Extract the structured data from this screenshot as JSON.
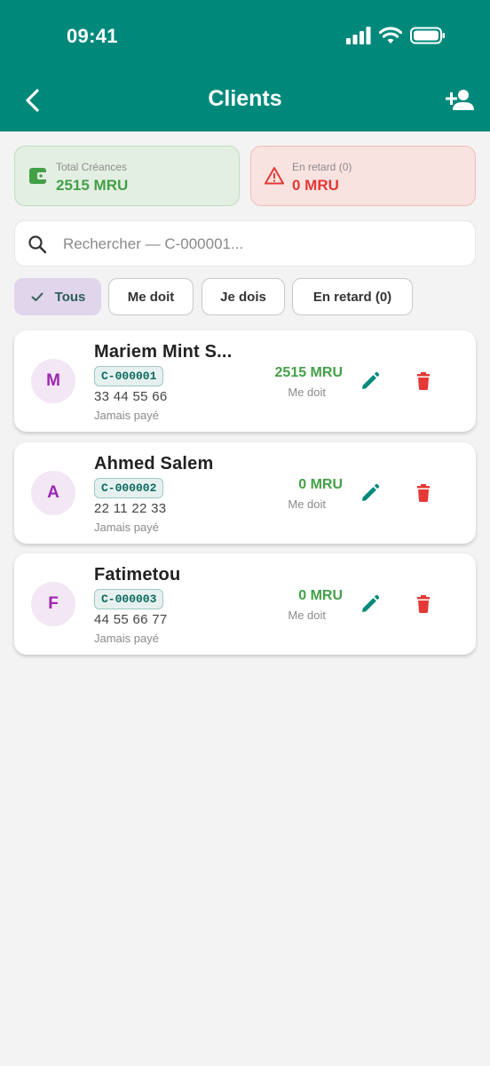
{
  "status_bar": {
    "time": "09:41"
  },
  "header": {
    "title": "Clients"
  },
  "summary": {
    "total": {
      "label": "Total Créances",
      "value": "2515 MRU"
    },
    "late": {
      "label": "En retard (0)",
      "value": "0 MRU"
    }
  },
  "search": {
    "placeholder": "Rechercher — C-000001...",
    "value": ""
  },
  "filters": [
    "Tous",
    "Me doit",
    "Je dois",
    "En retard (0)"
  ],
  "clients": [
    {
      "initial": "M",
      "name": "Mariem Mint S...",
      "code": "C-000001",
      "phone": "33 44 55 66",
      "paid": "Jamais payé",
      "amount": "2515 MRU",
      "status": "Me doit"
    },
    {
      "initial": "A",
      "name": "Ahmed Salem",
      "code": "C-000002",
      "phone": "22 11 22 33",
      "paid": "Jamais payé",
      "amount": "0 MRU",
      "status": "Me doit"
    },
    {
      "initial": "F",
      "name": "Fatimetou",
      "code": "C-000003",
      "phone": "44 55 66 77",
      "paid": "Jamais payé",
      "amount": "0 MRU",
      "status": "Me doit"
    }
  ],
  "colors": {
    "primary": "#00897b",
    "positive": "#43a047",
    "negative": "#e53935",
    "avatar": "#9c27b0"
  },
  "icons": [
    "back-arrow-icon",
    "add-person-icon",
    "wallet-icon",
    "warning-icon",
    "search-icon",
    "check-icon",
    "edit-icon",
    "delete-icon"
  ]
}
